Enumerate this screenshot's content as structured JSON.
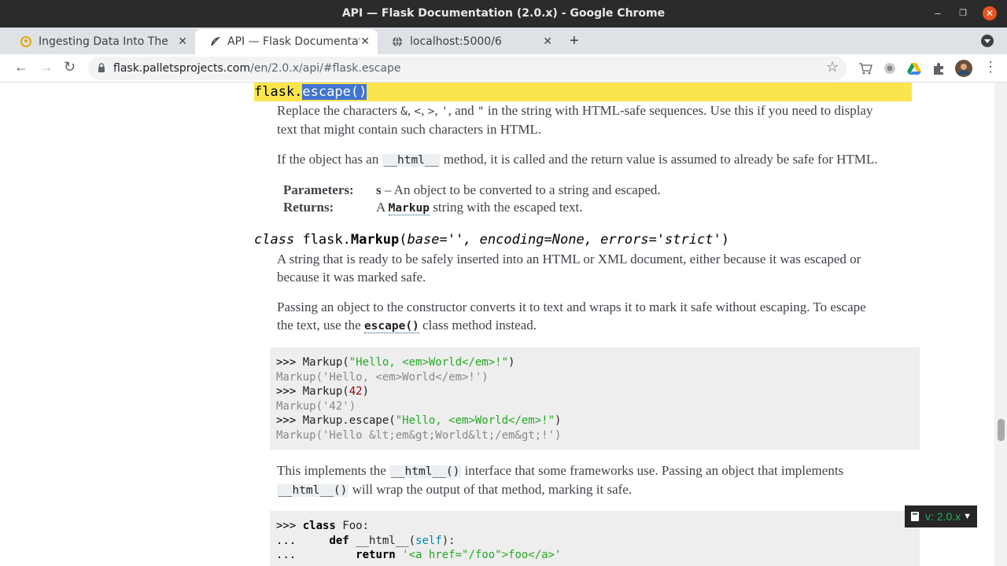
{
  "window": {
    "title": "API — Flask Documentation (2.0.x) - Google Chrome"
  },
  "tabs": [
    {
      "label": "Ingesting Data Into The Cl",
      "icon": "podcast-icon"
    },
    {
      "label": "API — Flask Documentati",
      "icon": "flask-icon"
    },
    {
      "label": "localhost:5000/6",
      "icon": "globe-icon"
    }
  ],
  "toolbar": {
    "url_host": "flask.palletsprojects.com",
    "url_path": "/en/2.0.x/api/#flask.escape"
  },
  "glyphs": {
    "minimize": "–",
    "maximize": "❐",
    "close": "✕",
    "tab_close": "✕",
    "new_tab": "+",
    "back": "←",
    "forward": "→",
    "reload": "↻",
    "star": "☆",
    "menu": "⋮"
  },
  "doc": {
    "escape_sig": {
      "module": "flask.",
      "name": "escape()"
    },
    "escape_desc_1a": "Replace the characters ",
    "escape_chars": [
      "&",
      "<",
      ">",
      "'",
      "\""
    ],
    "sep_comma": ",",
    "sep_and": ", and",
    "escape_desc_1b": " in the string with HTML-safe sequences. Use this if you need to display",
    "escape_desc_1c": "text that might contain such characters in HTML.",
    "escape_desc_2a": "If the object has an ",
    "escape_desc_2_code": "__html__",
    "escape_desc_2b": " method, it is called and the return value is assumed to already be safe for HTML.",
    "params_label": "Parameters:",
    "params_name": "s",
    "params_desc": " – An object to be converted to a string and escaped.",
    "returns_label": "Returns:",
    "returns_a": "A ",
    "returns_code": "Markup",
    "returns_b": " string with the escaped text.",
    "markup_sig": {
      "prefix": "class",
      "module": "flask.",
      "name": "Markup",
      "open": "(",
      "params": "base='', encoding=None, errors='strict'",
      "close": ")"
    },
    "markup_desc_1a": "A string that is ready to be safely inserted into an HTML or XML document, either because it was escaped or",
    "markup_desc_1b": "because it was marked safe.",
    "markup_desc_2a": "Passing an object to the constructor converts it to text and wraps it to mark it safe without escaping. To escape",
    "markup_desc_2b": "the text, use the ",
    "markup_desc_2_code": "escape()",
    "markup_desc_2c": " class method instead.",
    "code1": {
      "prompt": ">>> ",
      "fn": "Markup",
      "method": "Markup.escape",
      "str_hello": "\"Hello, <em>World</em>!\"",
      "out1": "Markup('Hello, <em>World</em>!')",
      "num": "42",
      "out2": "Markup('42')",
      "out3": "Markup('Hello &lt;em&gt;World&lt;/em&gt;!')"
    },
    "impl_a": "This implements the ",
    "impl_code": "__html__()",
    "impl_b": " interface that some frameworks use. Passing an object that implements",
    "impl_code2": "__html__()",
    "impl_c": " will wrap the output of that method, marking it safe.",
    "code2": {
      "prompt": ">>> ",
      "cont": "... ",
      "kw_class": "class",
      "cls_name": " Foo:",
      "kw_def": "def",
      "fn_name": " __html__(",
      "self": "self",
      "fn_end": "):",
      "kw_return": "return",
      "ret_str": " '<a href=\"/foo\">foo</a>'"
    }
  },
  "version_badge": "v: 2.0.x"
}
